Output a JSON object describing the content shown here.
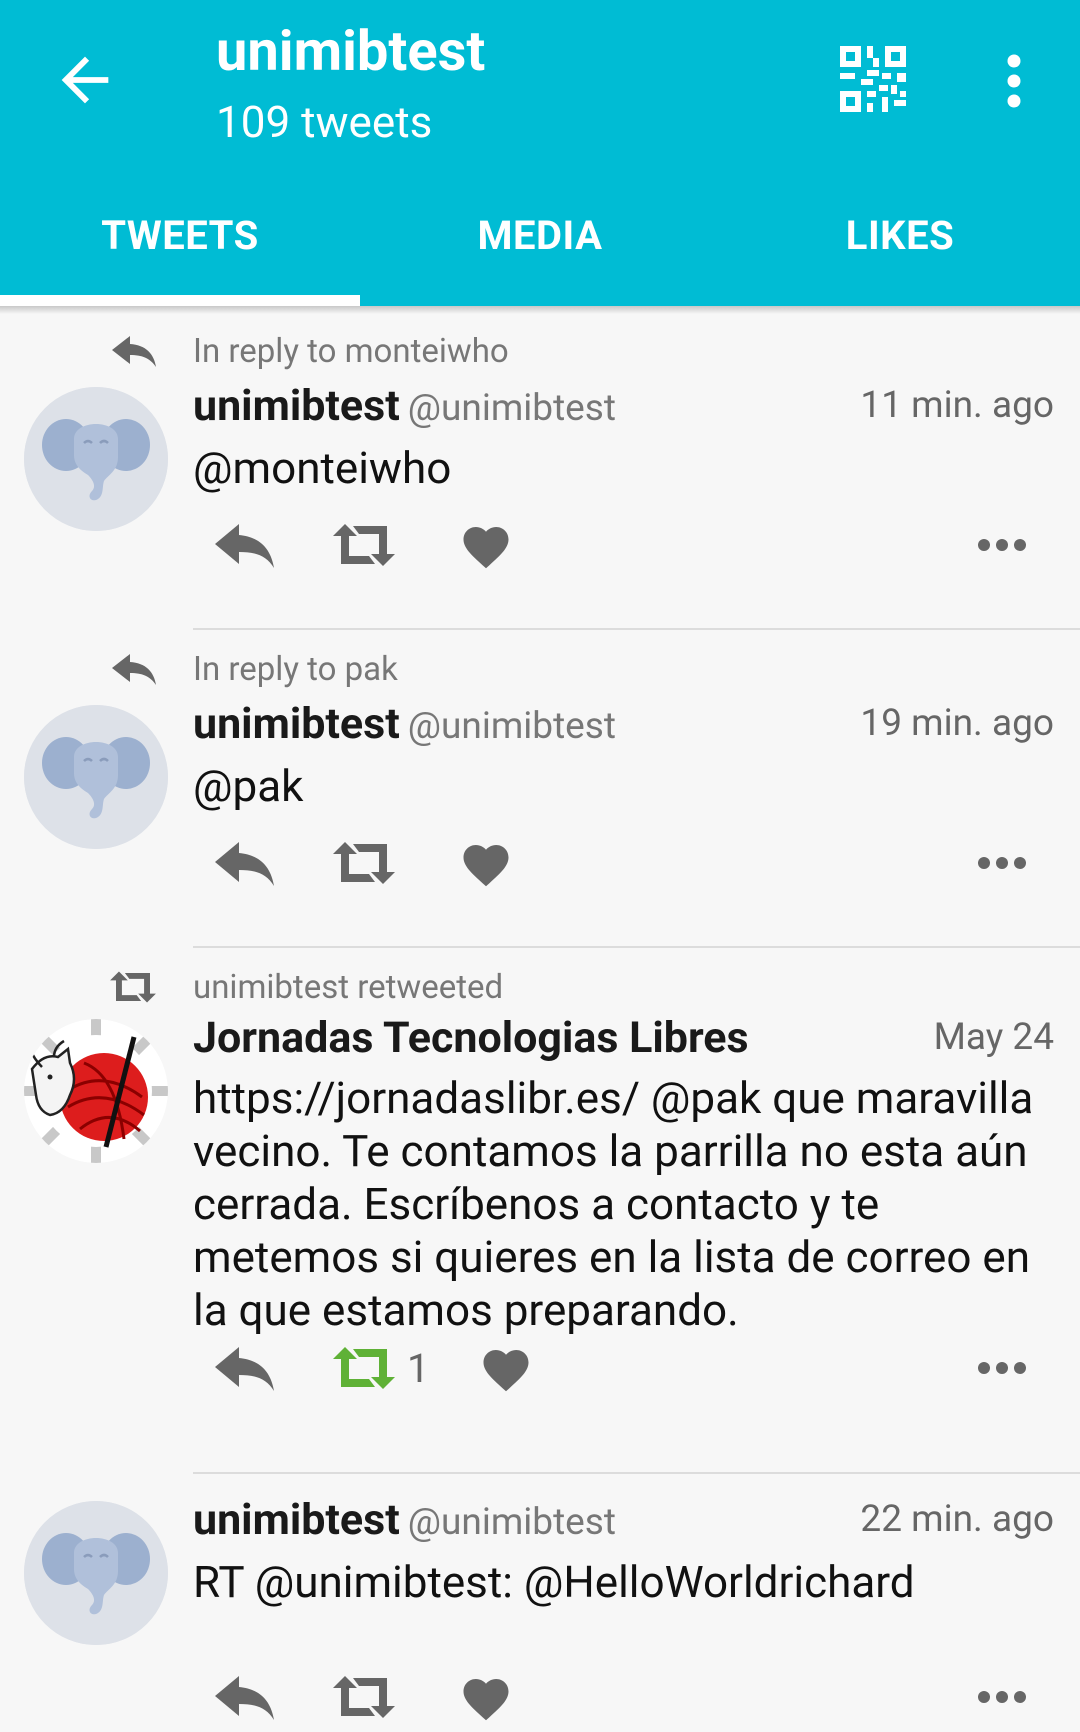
{
  "header": {
    "title": "unimibtest",
    "subtitle": "109 tweets",
    "back_icon": "arrow-left-icon",
    "qr_icon": "qr-code-icon",
    "more_icon": "more-vert-icon"
  },
  "tabs": [
    {
      "label": "TWEETS",
      "selected": true
    },
    {
      "label": "MEDIA",
      "selected": false
    },
    {
      "label": "LIKES",
      "selected": false
    }
  ],
  "colors": {
    "accent": "#00bcd4",
    "retweet_active": "#5fb136",
    "icon_gray": "#666666"
  },
  "tweets": [
    {
      "context": "In reply to monteiwho",
      "context_icon": "reply-icon",
      "name": "unimibtest",
      "handle": "@unimibtest",
      "time": "11 min. ago",
      "text": "@monteiwho",
      "retweet_count": ""
    },
    {
      "context": "In reply to pak",
      "context_icon": "reply-icon",
      "name": "unimibtest",
      "handle": "@unimibtest",
      "time": "19 min. ago",
      "text": "@pak",
      "retweet_count": ""
    },
    {
      "context": "unimibtest retweeted",
      "context_icon": "retweet-icon",
      "name": "Jornadas Tecnologias Libres",
      "handle": "",
      "time": "May 24",
      "text": "https://jornadaslibr.es/ @pak que maravilla vecino. Te contamos la parrilla no esta aún cerrada. Escríbenos a contacto y te metemos si quieres en la lista de correo en la que estamos preparando.",
      "retweet_count": "1"
    },
    {
      "context": "",
      "context_icon": "",
      "name": "unimibtest",
      "handle": "@unimibtest",
      "time": "22 min. ago",
      "text": "RT @unimibtest: @HelloWorldrichard",
      "retweet_count": ""
    }
  ]
}
